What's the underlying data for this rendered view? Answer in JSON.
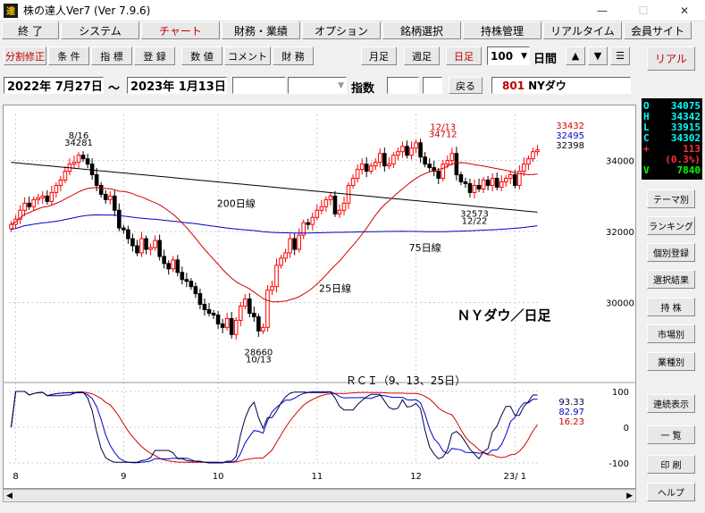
{
  "window": {
    "title": "株の達人Ver7 (Ver 7.9.6)",
    "icon_text": "達"
  },
  "menu": [
    {
      "label": "終 了"
    },
    {
      "label": "システム"
    },
    {
      "label": "チャート",
      "active": true
    },
    {
      "label": "財務・業績"
    },
    {
      "label": "オプション"
    },
    {
      "label": "銘柄選択"
    },
    {
      "label": "持株管理"
    },
    {
      "label": "リアルタイム"
    },
    {
      "label": "会員サイト"
    }
  ],
  "toolbar": {
    "left_buttons": [
      "分割修正",
      "条 件",
      "指 標",
      "登 録",
      "数 値",
      "コメント",
      "財 務"
    ],
    "period_buttons": [
      "月足",
      "週足",
      "日足"
    ],
    "count_value": "100",
    "count_unit": "日間",
    "up_arrow": "▲",
    "down_arrow": "▼",
    "menu_glyph": "☰",
    "real_label": "リアル"
  },
  "datebar": {
    "start_date": "2022年 7月27日",
    "tilde": "〜",
    "end_date": "2023年 1月13日",
    "index_label": "指数",
    "back_label": "戻る",
    "code": "801",
    "name": "NYダウ"
  },
  "quote": [
    {
      "k": "O",
      "v": "34075",
      "color": "#00ffff"
    },
    {
      "k": "H",
      "v": "34342",
      "color": "#00ffff"
    },
    {
      "k": "L",
      "v": "33915",
      "color": "#00ffff"
    },
    {
      "k": "C",
      "v": "34302",
      "color": "#00ffff"
    },
    {
      "k": "+",
      "v": "113",
      "color": "#ff3030"
    },
    {
      "k": "",
      "v": "(0.3%)",
      "color": "#ff3030"
    },
    {
      "k": "V",
      "v": "7840",
      "color": "#00ff00"
    }
  ],
  "side_buttons": [
    "テーマ別",
    "ランキング",
    "個別登録",
    "選択結果",
    "持 株",
    "市場別",
    "業種別",
    "連続表示",
    "一 覧",
    "印 刷",
    "ヘルプ"
  ],
  "colors": {
    "up": "#ff0000",
    "down": "#000000",
    "ma25": "#d40000",
    "ma75": "#0000c8",
    "ma200": "#000000",
    "rci9": "#000040",
    "rci13": "#0000c8",
    "rci25": "#d40000"
  },
  "chart_data": {
    "type": "candlestick",
    "title": "ＮＹダウ／日足",
    "y_ticks": [
      30000,
      32000,
      34000
    ],
    "ylim": [
      28000,
      35300
    ],
    "x_month_labels": [
      {
        "label": "8",
        "index": 1
      },
      {
        "label": "9",
        "index": 25
      },
      {
        "label": "10",
        "index": 46
      },
      {
        "label": "11",
        "index": 68
      },
      {
        "label": "12",
        "index": 90
      },
      {
        "label": "23/ 1",
        "index": 112
      }
    ],
    "ma_legend": [
      {
        "label": "33432",
        "color": "#d40000"
      },
      {
        "label": "32495",
        "color": "#0000c8"
      },
      {
        "label": "32398",
        "color": "#000000"
      }
    ],
    "ma_labels": {
      "ma200": "200日線",
      "ma75": "75日線",
      "ma25": "25日線"
    },
    "annotations": [
      {
        "text": "8/16",
        "index": 15,
        "value": 34620
      },
      {
        "text": "34281",
        "index": 15,
        "value": 34420
      },
      {
        "text": "28660",
        "index": 55,
        "value": 28520
      },
      {
        "text": "10/13",
        "index": 55,
        "value": 28320
      },
      {
        "text": "12/13",
        "index": 96,
        "value": 34860,
        "color": "#d40000"
      },
      {
        "text": "34712",
        "index": 96,
        "value": 34660,
        "color": "#d40000"
      },
      {
        "text": "32573",
        "index": 103,
        "value": 32420
      },
      {
        "text": "12/22",
        "index": 103,
        "value": 32220
      }
    ],
    "closes": [
      32200,
      32350,
      32600,
      32800,
      32700,
      32900,
      32950,
      33000,
      32850,
      33100,
      33300,
      33450,
      33700,
      33900,
      33950,
      34150,
      34050,
      33900,
      33600,
      33300,
      33050,
      32900,
      33000,
      32600,
      32100,
      32050,
      31800,
      31600,
      31400,
      31800,
      31500,
      31550,
      31750,
      31300,
      31100,
      30950,
      31200,
      30850,
      30650,
      30600,
      30450,
      30250,
      29950,
      29800,
      29700,
      29650,
      29400,
      29300,
      29550,
      29100,
      29500,
      29900,
      30100,
      29700,
      29600,
      29200,
      29300,
      30350,
      30450,
      31050,
      31250,
      31400,
      31800,
      31500,
      31900,
      32250,
      32200,
      32400,
      32600,
      32700,
      32900,
      33000,
      32500,
      32600,
      32800,
      33300,
      33500,
      33750,
      33900,
      33700,
      33850,
      33950,
      34200,
      33850,
      33900,
      34150,
      34250,
      34400,
      34150,
      34350,
      34500,
      34100,
      33900,
      33800,
      33700,
      33500,
      33900,
      34000,
      34200,
      33600,
      33400,
      33350,
      33100,
      33300,
      33200,
      33450,
      33300,
      33500,
      33250,
      33400,
      33500,
      33600,
      33300,
      33700,
      33900,
      34050,
      34250,
      34300
    ]
  },
  "rci": {
    "title": "ＲＣＩ（9、13、25日）",
    "ticks": [
      100,
      0,
      -100
    ],
    "legend": [
      {
        "label": "93.33",
        "color": "#000040"
      },
      {
        "label": "82.97",
        "color": "#0000c8"
      },
      {
        "label": "16.23",
        "color": "#d40000"
      }
    ]
  }
}
